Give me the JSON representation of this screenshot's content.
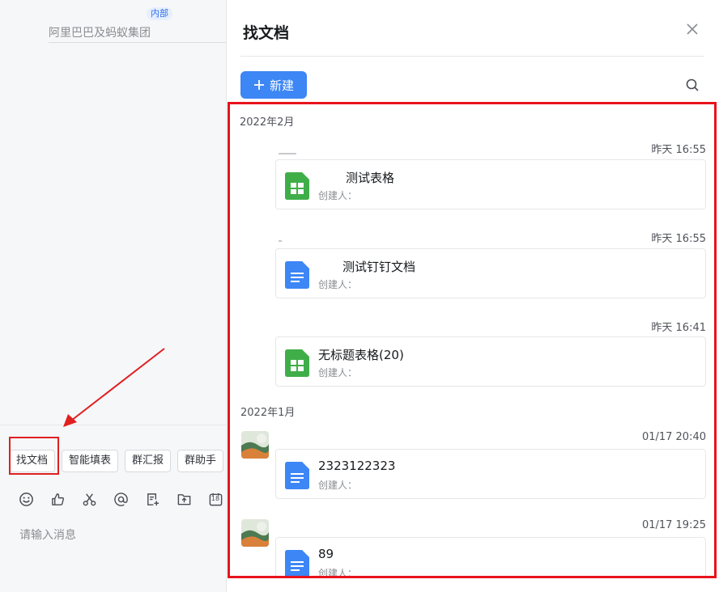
{
  "left": {
    "org_badge": "内部",
    "org_name": "阿里巴巴及蚂蚁集团",
    "quick_buttons": [
      "找文档",
      "智能填表",
      "群汇报",
      "群助手"
    ],
    "tools": [
      "emoji-icon",
      "thumbs-up-icon",
      "scissors-icon",
      "at-icon",
      "note-add-icon",
      "folder-upload-icon",
      "calendar-icon"
    ],
    "calendar_day": "18",
    "input_placeholder": "请输入消息"
  },
  "panel": {
    "title": "找文档",
    "new_button": "新建",
    "groups": [
      {
        "month": "2022年2月",
        "items": [
          {
            "time": "昨天 16:55",
            "type": "sheet",
            "title": "测试表格",
            "creator": "创建人："
          },
          {
            "time": "昨天 16:55",
            "type": "doc",
            "title": "测试钉钉文档",
            "creator": "创建人："
          },
          {
            "time": "昨天 16:41",
            "type": "sheet",
            "title": "无标题表格(20)",
            "creator": "创建人："
          }
        ]
      },
      {
        "month": "2022年1月",
        "items": [
          {
            "time": "01/17 20:40",
            "type": "doc",
            "title": "2323122323",
            "creator": "创建人："
          },
          {
            "time": "01/17 19:25",
            "type": "doc",
            "title": "89",
            "creator": "创建人："
          }
        ]
      }
    ]
  },
  "colors": {
    "accent": "#3d86f5",
    "sheet_green": "#3fae49",
    "doc_blue": "#3d86f5",
    "highlight_red": "#e8131c"
  }
}
